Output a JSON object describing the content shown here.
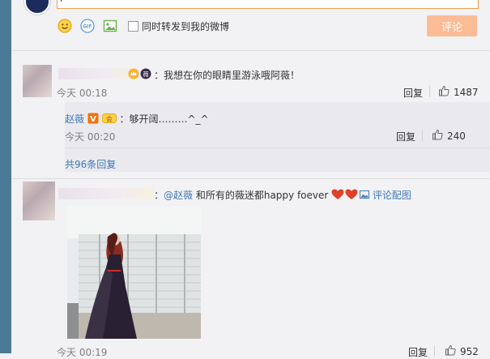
{
  "composer": {
    "repost_label": "同时转发到我的微博",
    "submit_label": "评论"
  },
  "comment1": {
    "text": "：我想在你的眼睛里游泳哦阿薇！",
    "time": "今天 00:18",
    "reply_label": "回复",
    "like_count": "1487"
  },
  "reply1": {
    "author": "赵薇",
    "text": "：够开阔………^_^",
    "time": "今天 00:20",
    "reply_label": "回复",
    "like_count": "240",
    "more_link": "共96条回复"
  },
  "comment2": {
    "mention": "@赵薇",
    "text": " 和所有的薇迷都happy foever",
    "pic_link": "评论配图",
    "time": "今天 00:19",
    "reply_label": "回复",
    "like_count": "952"
  },
  "colors": {
    "accent": "#fcbc96",
    "link": "#3e78b5",
    "heart": "#e0402a"
  }
}
